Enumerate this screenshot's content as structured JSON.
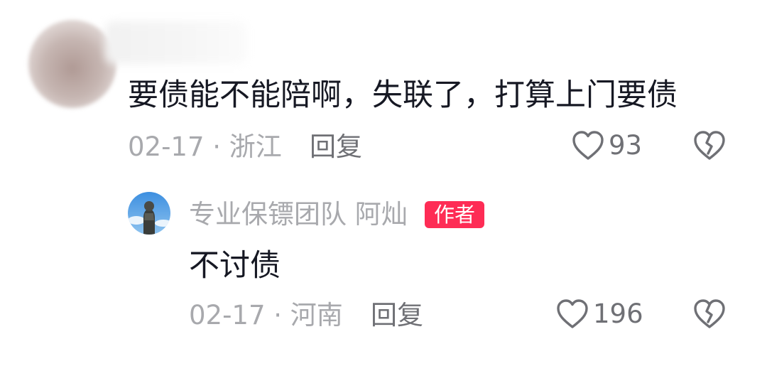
{
  "comment": {
    "text": "要债能不能陪啊，失联了，打算上门要债",
    "date_location": "02-17 · 浙江",
    "reply_label": "回复",
    "like_count": "93"
  },
  "reply": {
    "author_name": "专业保镖团队 阿灿",
    "author_badge": "作者",
    "text": "不讨债",
    "date_location": "02-17 · 河南",
    "reply_label": "回复",
    "like_count": "196"
  },
  "colors": {
    "text_primary": "#161823",
    "text_secondary": "#a8a9ad",
    "badge_bg": "#fe2c55",
    "icon": "#6f7075"
  },
  "icons": {
    "like": "heart-outline-icon",
    "dislike": "broken-heart-icon"
  }
}
